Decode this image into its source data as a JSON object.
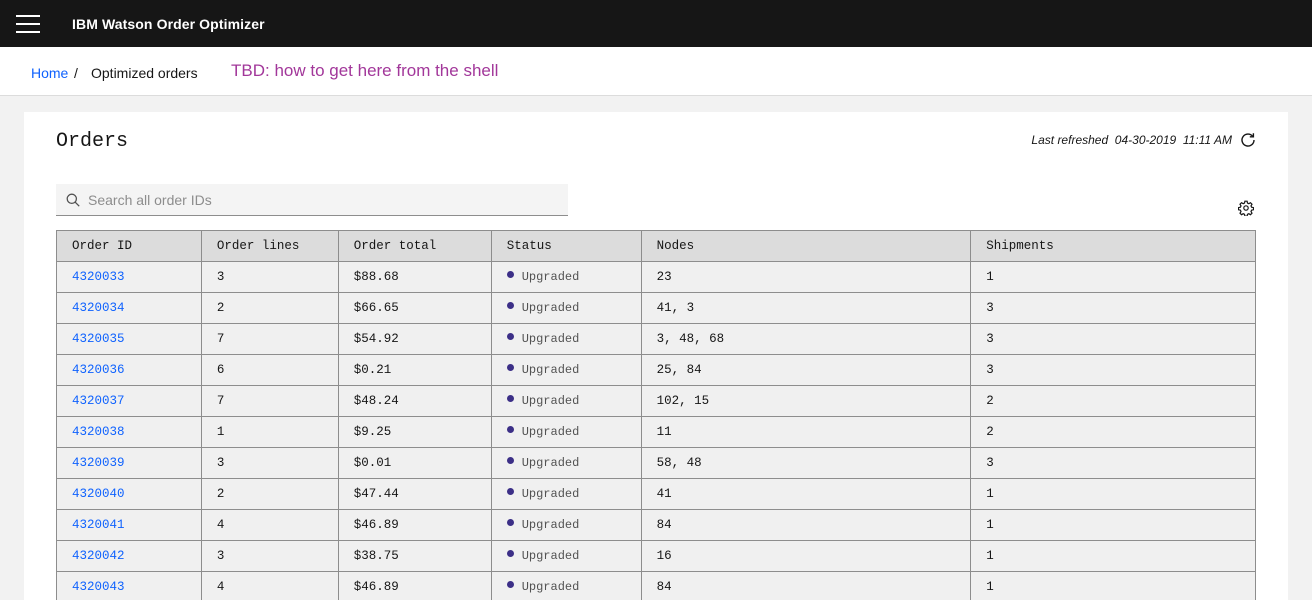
{
  "app": {
    "title": "IBM Watson Order Optimizer"
  },
  "breadcrumb": {
    "home": "Home",
    "separator": "/",
    "current": "Optimized orders"
  },
  "note": "TBD: how to get here from the shell",
  "page": {
    "title": "Orders",
    "refresh_label": "Last refreshed  04-30-2019  11:11 AM"
  },
  "search": {
    "placeholder": "Search all order IDs"
  },
  "colors": {
    "accent": "#0f62fe",
    "status_dot": "#3c2f87",
    "note": "#a2379a",
    "topbar": "#161616"
  },
  "icons": [
    "menu-icon",
    "refresh-icon",
    "search-icon",
    "gear-icon"
  ],
  "table": {
    "headers": [
      "Order ID",
      "Order lines",
      "Order total",
      "Status",
      "Nodes",
      "Shipments"
    ],
    "rows": [
      {
        "id": "4320033",
        "lines": "3",
        "total": "$88.68",
        "status": "Upgraded",
        "nodes": "23",
        "shipments": "1"
      },
      {
        "id": "4320034",
        "lines": "2",
        "total": "$66.65",
        "status": "Upgraded",
        "nodes": "41, 3",
        "shipments": "3"
      },
      {
        "id": "4320035",
        "lines": "7",
        "total": "$54.92",
        "status": "Upgraded",
        "nodes": "3, 48, 68",
        "shipments": "3"
      },
      {
        "id": "4320036",
        "lines": "6",
        "total": "$0.21",
        "status": "Upgraded",
        "nodes": "25, 84",
        "shipments": "3"
      },
      {
        "id": "4320037",
        "lines": "7",
        "total": "$48.24",
        "status": "Upgraded",
        "nodes": "102, 15",
        "shipments": "2"
      },
      {
        "id": "4320038",
        "lines": "1",
        "total": "$9.25",
        "status": "Upgraded",
        "nodes": "11",
        "shipments": "2"
      },
      {
        "id": "4320039",
        "lines": "3",
        "total": "$0.01",
        "status": "Upgraded",
        "nodes": "58, 48",
        "shipments": "3"
      },
      {
        "id": "4320040",
        "lines": "2",
        "total": "$47.44",
        "status": "Upgraded",
        "nodes": "41",
        "shipments": "1"
      },
      {
        "id": "4320041",
        "lines": "4",
        "total": "$46.89",
        "status": "Upgraded",
        "nodes": "84",
        "shipments": "1"
      },
      {
        "id": "4320042",
        "lines": "3",
        "total": "$38.75",
        "status": "Upgraded",
        "nodes": "16",
        "shipments": "1"
      },
      {
        "id": "4320043",
        "lines": "4",
        "total": "$46.89",
        "status": "Upgraded",
        "nodes": "84",
        "shipments": "1"
      }
    ]
  }
}
